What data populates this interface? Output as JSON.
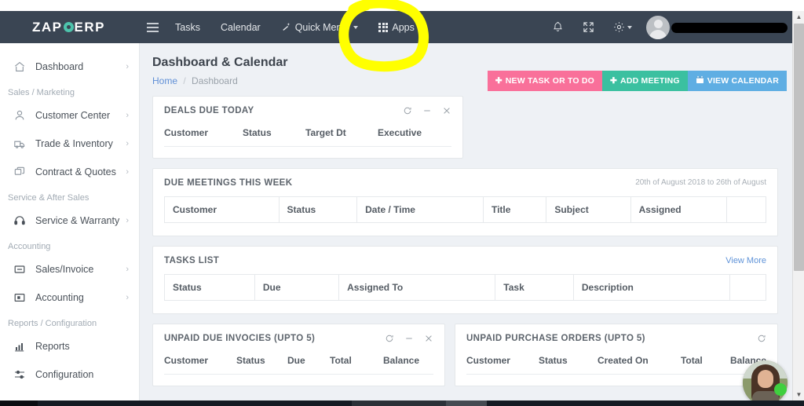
{
  "brand": {
    "part1": "ZAP",
    "part2": "ERP"
  },
  "topnav": {
    "menu_icon": "hamburger-icon",
    "items": [
      {
        "label": "Tasks",
        "icon": ""
      },
      {
        "label": "Calendar",
        "icon": ""
      },
      {
        "label": "Quick Menu",
        "icon": "magic-wand-icon",
        "caret": true
      },
      {
        "label": "Apps",
        "icon": "grid-icon",
        "caret": true
      }
    ],
    "right_icons": [
      "bell-icon",
      "fullscreen-icon",
      "gear-icon"
    ],
    "user": {
      "name_redacted": true
    }
  },
  "sidebar": {
    "items": [
      {
        "type": "item",
        "label": "Dashboard",
        "icon": "home-icon",
        "chevron": "›"
      },
      {
        "type": "header",
        "label": "Sales / Marketing"
      },
      {
        "type": "item",
        "label": "Customer Center",
        "icon": "user-icon",
        "chevron": "›"
      },
      {
        "type": "item",
        "label": "Trade & Inventory",
        "icon": "truck-icon",
        "chevron": "›"
      },
      {
        "type": "item",
        "label": "Contract & Quotes",
        "icon": "copy-icon",
        "chevron": "›"
      },
      {
        "type": "header",
        "label": "Service & After Sales"
      },
      {
        "type": "item",
        "label": "Service & Warranty",
        "icon": "headset-icon",
        "chevron": "›"
      },
      {
        "type": "header",
        "label": "Accounting"
      },
      {
        "type": "item",
        "label": "Sales/Invoice",
        "icon": "invoice-icon",
        "chevron": "›"
      },
      {
        "type": "item",
        "label": "Accounting",
        "icon": "ledger-icon",
        "chevron": "›"
      },
      {
        "type": "header",
        "label": "Reports / Configuration"
      },
      {
        "type": "item",
        "label": "Reports",
        "icon": "bar-chart-icon",
        "chevron": ""
      },
      {
        "type": "item",
        "label": "Configuration",
        "icon": "sliders-icon",
        "chevron": ""
      }
    ]
  },
  "page": {
    "title": "Dashboard & Calendar",
    "breadcrumb": {
      "home": "Home",
      "separator": "/",
      "current": "Dashboard"
    }
  },
  "actions": [
    {
      "label": "NEW TASK OR TO DO",
      "icon": "plus-icon",
      "color": "#f9709a"
    },
    {
      "label": "ADD MEETING",
      "icon": "plus-icon",
      "color": "#3bc0a0"
    },
    {
      "label": "VIEW CALENDAR",
      "icon": "calendar-icon",
      "color": "#5faee3"
    }
  ],
  "panels": {
    "deals_due_today": {
      "title": "DEALS DUE TODAY",
      "tools": [
        "refresh-icon",
        "minimize-icon",
        "close-icon"
      ],
      "columns": [
        "Customer",
        "Status",
        "Target Dt",
        "Executive"
      ]
    },
    "due_meetings": {
      "title": "DUE MEETINGS THIS WEEK",
      "date_range": "20th of August 2018 to 26th of August",
      "columns": [
        "Customer",
        "Status",
        "Date / Time",
        "Title",
        "Subject",
        "Assigned",
        ""
      ]
    },
    "tasks_list": {
      "title": "TASKS LIST",
      "view_more": "View More",
      "columns": [
        "Status",
        "Due",
        "Assigned To",
        "Task",
        "Description",
        ""
      ]
    },
    "unpaid_invoices": {
      "title": "UNPAID DUE INVOCIES (UPTO 5)",
      "tools": [
        "refresh-icon",
        "minimize-icon",
        "close-icon"
      ],
      "columns": [
        "Customer",
        "Status",
        "Due",
        "Total",
        "Balance"
      ]
    },
    "unpaid_purchase_orders": {
      "title": "UNPAID PURCHASE ORDERS (UPTO 5)",
      "tools": [
        "refresh-icon"
      ],
      "columns": [
        "Customer",
        "Status",
        "Created On",
        "Total",
        "Balance"
      ]
    }
  },
  "chat_widget": {
    "status": "online",
    "status_color": "#3fcf3f"
  },
  "annotation": {
    "type": "highlight-circle",
    "color": "#ffff00",
    "target": "Apps"
  },
  "colors": {
    "navbar": "#3a4553",
    "brand_accent": "#4dc3ac",
    "page_bg": "#eef1f5",
    "link": "#5f8fd6"
  }
}
